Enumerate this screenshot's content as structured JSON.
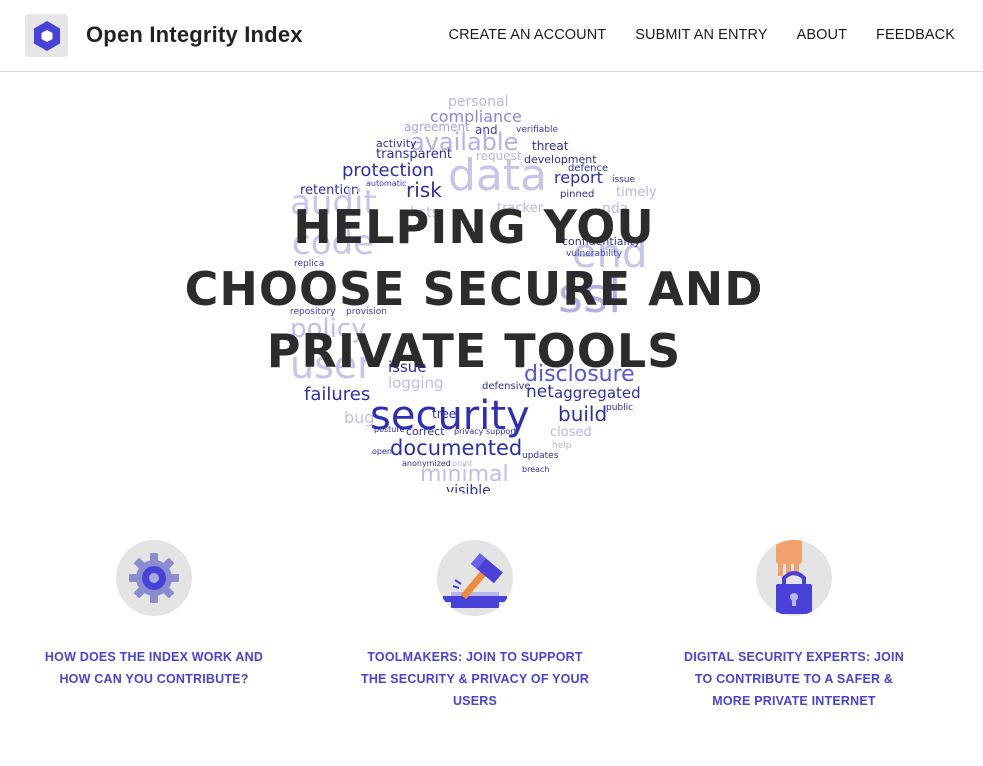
{
  "header": {
    "brand": "Open Integrity Index",
    "nav": [
      "CREATE AN ACCOUNT",
      "SUBMIT AN ENTRY",
      "ABOUT",
      "FEEDBACK"
    ]
  },
  "hero": {
    "headline_lines": [
      "HELPING YOU",
      "CHOOSE SECURE AND",
      "PRIVATE TOOLS"
    ],
    "word_cloud": [
      "personal",
      "compliance",
      "agreement",
      "and",
      "verifiable",
      "available",
      "activity",
      "threat",
      "transparent",
      "request",
      "development",
      "protection",
      "data",
      "defence",
      "report",
      "issue",
      "retention",
      "automatic",
      "risk",
      "timely",
      "pinned",
      "audit",
      "hsts",
      "tracker",
      "nda",
      "code",
      "end",
      "confidentiality",
      "vulnerability",
      "ssl",
      "replica",
      "repository",
      "provision",
      "policy",
      "user",
      "issue",
      "logging",
      "disclosure",
      "defensive",
      "failures",
      "net",
      "aggregated",
      "security",
      "build",
      "bug",
      "tree",
      "public",
      "posture",
      "correct",
      "privacy",
      "support",
      "closed",
      "documented",
      "help",
      "open",
      "updates",
      "anonymized",
      "point",
      "breach",
      "minimal",
      "visible"
    ]
  },
  "features": [
    {
      "label": "HOW DOES THE INDEX WORK AND HOW CAN YOU CONTRIBUTE?",
      "icon": "gear-icon"
    },
    {
      "label": "TOOLMAKERS: JOIN TO SUPPORT THE SECURITY & PRIVACY OF YOUR USERS",
      "icon": "hammer-icon"
    },
    {
      "label": "DIGITAL SECURITY EXPERTS: JOIN TO CONTRIBUTE TO A SAFER & MORE PRIVATE INTERNET",
      "icon": "padlock-hand-icon"
    }
  ],
  "colors": {
    "accent": "#4a41d9",
    "text": "#2c2c2c",
    "icon_bg": "#e4e4e4"
  }
}
